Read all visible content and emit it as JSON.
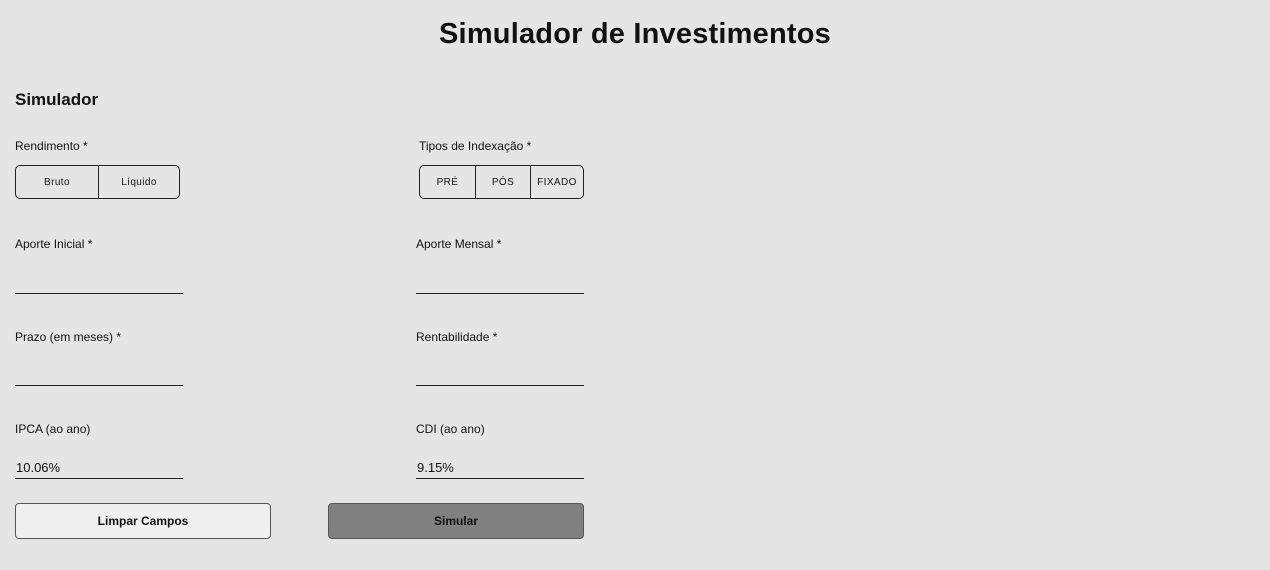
{
  "page_title": "Simulador de Investimentos",
  "section_title": "Simulador",
  "rendimento": {
    "label": "Rendimento *",
    "options": [
      "Bruto",
      "Líquido"
    ]
  },
  "indexacao": {
    "label": "Tipos de Indexação *",
    "options": [
      "PRÉ",
      "PÓS",
      "FIXADO"
    ]
  },
  "fields": {
    "aporte_inicial": {
      "label": "Aporte Inicial *",
      "value": ""
    },
    "aporte_mensal": {
      "label": "Aporte Mensal *",
      "value": ""
    },
    "prazo": {
      "label": "Prazo (em meses) *",
      "value": ""
    },
    "rentabilidade": {
      "label": "Rentabilidade *",
      "value": ""
    },
    "ipca": {
      "label": "IPCA (ao ano)",
      "value": "10.06%"
    },
    "cdi": {
      "label": "CDI (ao ano)",
      "value": "9.15%"
    }
  },
  "buttons": {
    "clear": "Limpar Campos",
    "submit": "Simular"
  },
  "colors": {
    "background": "#e5e5e5",
    "submit_button": "#808080",
    "clear_button": "#f0f0f0"
  }
}
